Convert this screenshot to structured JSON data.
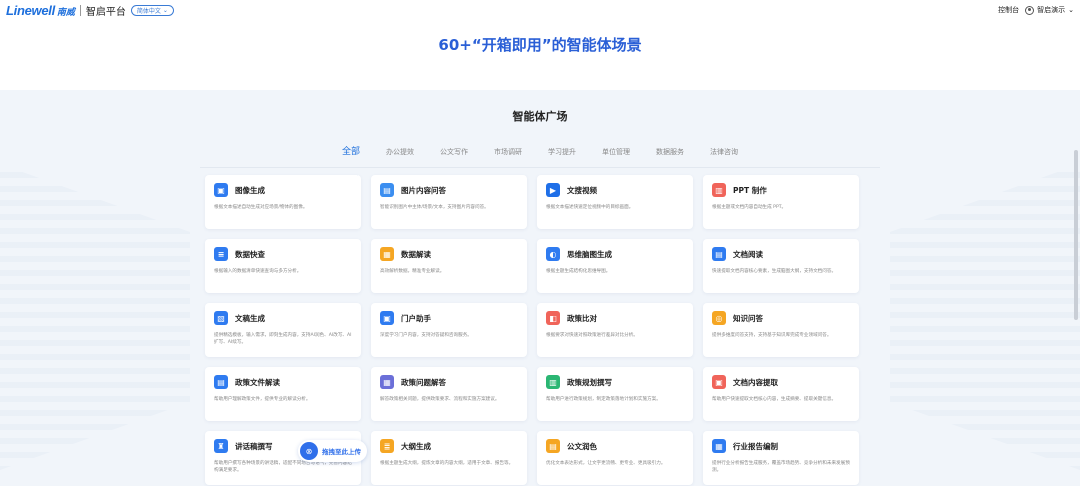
{
  "header": {
    "logo_en": "Linewell",
    "logo_cn": "南威",
    "platform": "智启平台",
    "lang_label": "简体中文",
    "console_label": "控制台",
    "user_label": "智启演示"
  },
  "banner": {
    "title": "60+“开箱即用”的智能体场景"
  },
  "plaza": {
    "title": "智能体广场",
    "tabs": [
      "全部",
      "办公提效",
      "公文写作",
      "市场调研",
      "学习提升",
      "单位管理",
      "数据服务",
      "法律咨询"
    ],
    "cards": [
      {
        "title": "图像生成",
        "desc": "根据文本描述自动生成对应场景/物体的图像。",
        "icon": "image-icon",
        "color": "#2f7bf0",
        "glyph": "▣"
      },
      {
        "title": "图片内容问答",
        "desc": "智能识别图片中主体/场景/文本，支持图片内容问答。",
        "icon": "picture-qa-icon",
        "color": "#3b8ef0",
        "glyph": "▤"
      },
      {
        "title": "文搜视频",
        "desc": "根据文本描述快速定位视频中的目标画面。",
        "icon": "video-icon",
        "color": "#1f6fe8",
        "glyph": "▶"
      },
      {
        "title": "PPT 制作",
        "desc": "根据主题或文档内容自动生成 PPT。",
        "icon": "ppt-icon",
        "color": "#f0645a",
        "glyph": "▥"
      },
      {
        "title": "数据快查",
        "desc": "根据输入的数据清单快速查询与多方分析。",
        "icon": "database-icon",
        "color": "#2f7bf0",
        "glyph": "≡"
      },
      {
        "title": "数据解读",
        "desc": "高效解析数据，精准专业解读。",
        "icon": "data-read-icon",
        "color": "#f5a623",
        "glyph": "▦"
      },
      {
        "title": "思维脑图生成",
        "desc": "根据主题生成结构化思维导图。",
        "icon": "mindmap-icon",
        "color": "#2f7bf0",
        "glyph": "◐"
      },
      {
        "title": "文档阅读",
        "desc": "快速提取文档内容核心要素，生成脑图大纲，支持文档问答。",
        "icon": "doc-read-icon",
        "color": "#2f7bf0",
        "glyph": "▤"
      },
      {
        "title": "文稿生成",
        "desc": "提供精选模板，输入需求，即刻生成内容，支持AI润色、AI改写、AI扩写、AI续写。",
        "icon": "draft-icon",
        "color": "#2f7bf0",
        "glyph": "▧"
      },
      {
        "title": "门户助手",
        "desc": "深度学习门户内容，支持对答疑和咨询服务。",
        "icon": "portal-icon",
        "color": "#2f7bf0",
        "glyph": "▣"
      },
      {
        "title": "政策比对",
        "desc": "根据要求对快速对照政策进行差异对比分析。",
        "icon": "compare-icon",
        "color": "#f0645a",
        "glyph": "◧"
      },
      {
        "title": "知识问答",
        "desc": "提供多维度问答支持，支持基于知识库完成专业领域问答。",
        "icon": "knowledge-icon",
        "color": "#f5a623",
        "glyph": "◎"
      },
      {
        "title": "政策文件解读",
        "desc": "帮助用户理解政策文件，提供专业的解读分析。",
        "icon": "policy-file-icon",
        "color": "#2f7bf0",
        "glyph": "▤"
      },
      {
        "title": "政策问题解答",
        "desc": "解答政策相关问题，提供政策要求、流程和实施方案建议。",
        "icon": "policy-qa-icon",
        "color": "#6b6fd8",
        "glyph": "▦"
      },
      {
        "title": "政策规划撰写",
        "desc": "帮助用户进行政策规划，制定政策落地计划和实施方案。",
        "icon": "policy-plan-icon",
        "color": "#2bb673",
        "glyph": "▥"
      },
      {
        "title": "文档内容提取",
        "desc": "帮助用户快速提取文档核心内容，生成摘要、提取关键信息。",
        "icon": "extract-icon",
        "color": "#f0645a",
        "glyph": "▣"
      },
      {
        "title": "讲话稿撰写",
        "desc": "帮助用户撰写各种场景的讲话稿，适配不同场合与语气，完善内容结构满足要求。",
        "icon": "speech-icon",
        "color": "#2f7bf0",
        "glyph": "♜"
      },
      {
        "title": "大纲生成",
        "desc": "根据主题生成大纲，提炼文章的内容大纲，适用于文章、报告等。",
        "icon": "outline-icon",
        "color": "#f5a623",
        "glyph": "≣"
      },
      {
        "title": "公文润色",
        "desc": "优化文本表达形式，让文字更流畅、更专业、更具吸引力。",
        "icon": "polish-icon",
        "color": "#f5a623",
        "glyph": "▤"
      },
      {
        "title": "行业报告编制",
        "desc": "提供行业分析报告生成服务，覆盖市场趋势、竞争分析和未来发展预测。",
        "icon": "report-icon",
        "color": "#2f7bf0",
        "glyph": "▦"
      }
    ],
    "float_button": {
      "label": "拖拽至此上传",
      "icon": "upload-icon"
    }
  }
}
